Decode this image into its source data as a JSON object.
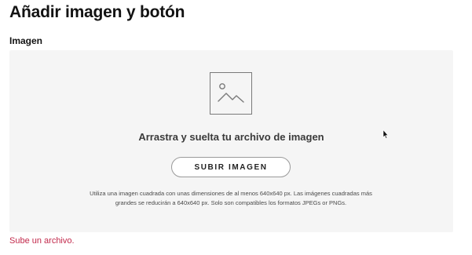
{
  "page": {
    "title": "Añadir imagen y botón"
  },
  "image_section": {
    "label": "Imagen",
    "dropzone": {
      "icon": "image-placeholder-icon",
      "drop_text": "Arrastra y suelta tu archivo de imagen",
      "upload_button_label": "SUBIR IMAGEN",
      "help_text_line1": "Utiliza una imagen cuadrada con unas dimensiones de al menos 640x640 px. Las imágenes cuadradas más",
      "help_text_line2": "grandes se reducirán a 640x640 px. Solo son compatibles los formatos JPEGs or PNGs."
    },
    "error_message": "Sube un archivo."
  },
  "colors": {
    "error": "#c2294b",
    "dropzone_bg": "#f5f5f5",
    "text_primary": "#121212"
  }
}
